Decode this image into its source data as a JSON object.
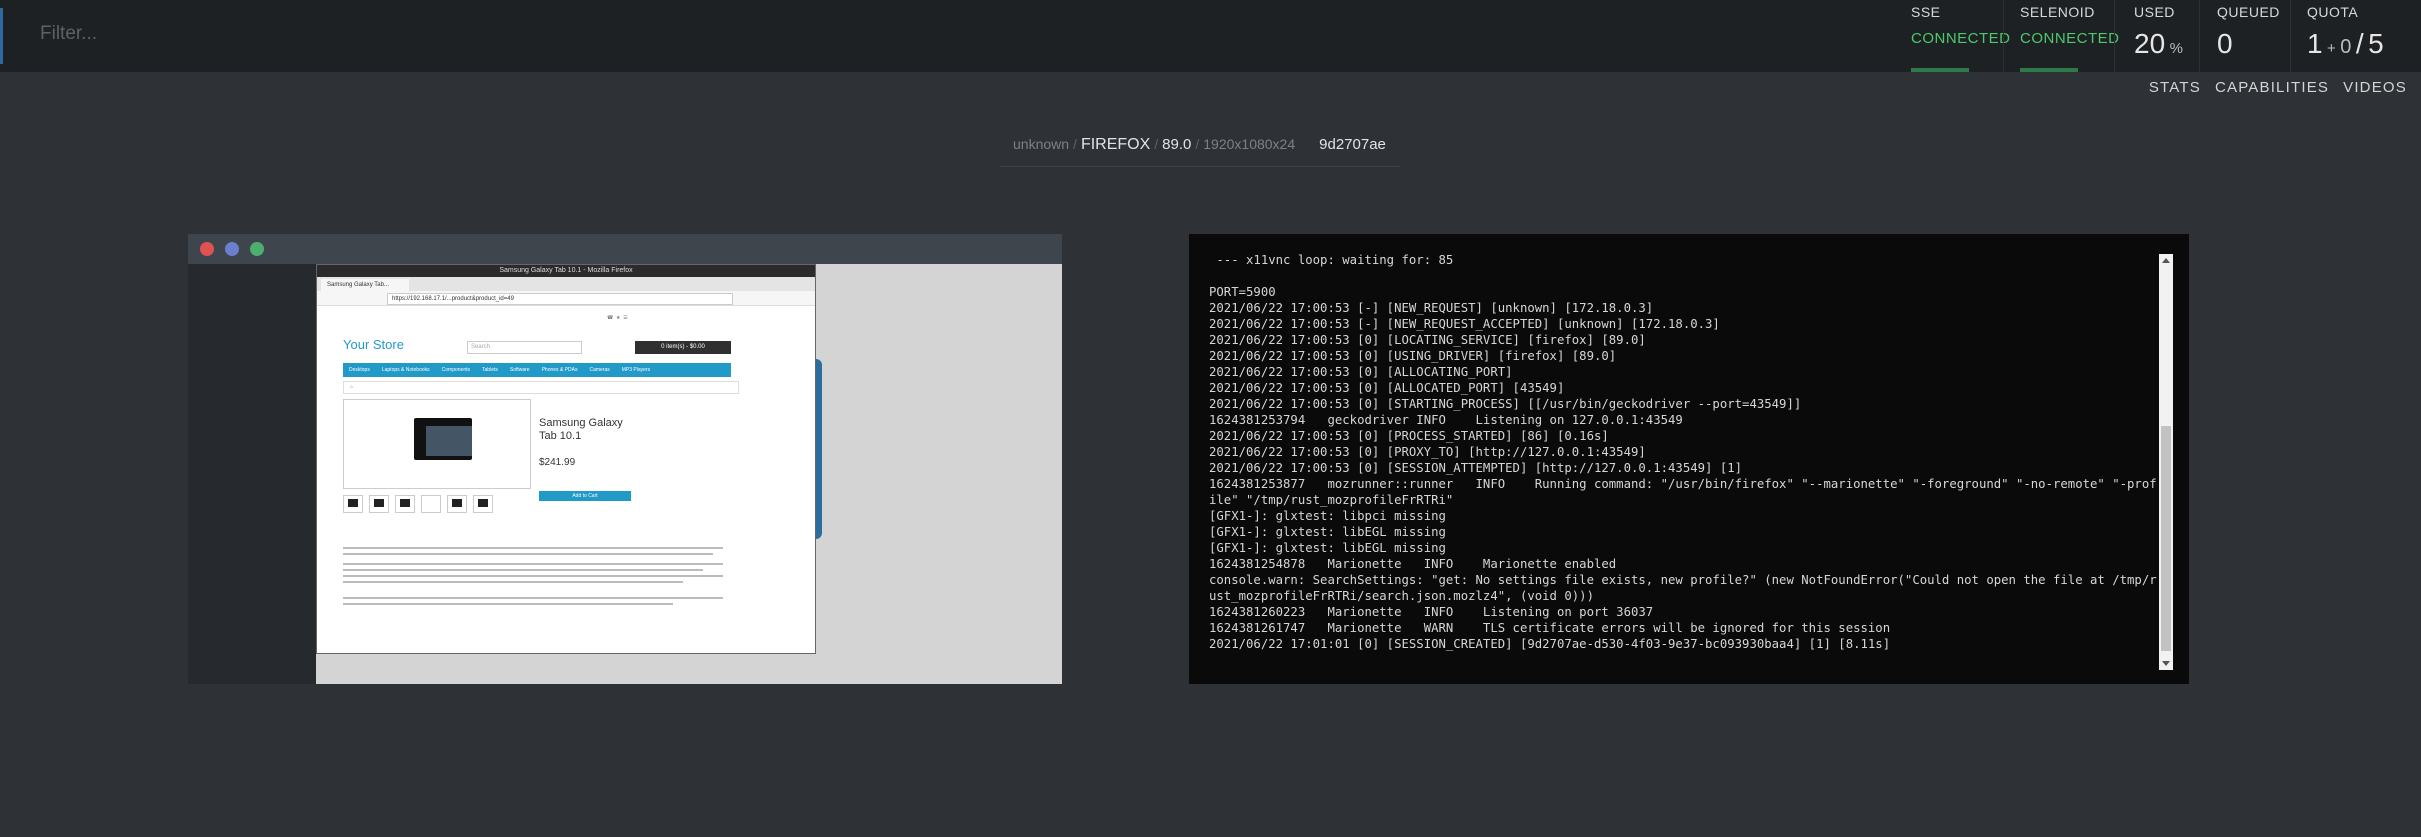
{
  "header": {
    "filter_placeholder": "Filter...",
    "sse": {
      "label": "SSE",
      "status": "CONNECTED"
    },
    "selenoid": {
      "label": "SELENOID",
      "status": "CONNECTED"
    },
    "used": {
      "label": "USED",
      "value": "20",
      "unit": "%"
    },
    "queued": {
      "label": "QUEUED",
      "value": "0"
    },
    "quota": {
      "label": "QUOTA",
      "used": "1",
      "plus": "+",
      "queued": "0",
      "slash": "/",
      "total": "5"
    },
    "accent_color": "#4cc96a"
  },
  "nav": [
    "STATS",
    "CAPABILITIES",
    "VIDEOS"
  ],
  "session": {
    "user": "unknown",
    "browser": "FIREFOX",
    "version": "89.0",
    "resolution": "1920x1080x24",
    "id": "9d2707ae"
  },
  "vnc": {
    "window_title": "Samsung Galaxy Tab 10.1 - Mozilla Firefox",
    "tab_title": "Samsung Galaxy Tab...",
    "url": "https://192.168.17.1/...product&product_id=49",
    "store_name": "Your Store",
    "search_placeholder": "Search",
    "cart_label": "0 item(s) - $0.00",
    "menu": [
      "Desktops",
      "Laptops & Notebooks",
      "Components",
      "Tablets",
      "Software",
      "Phones & PDAs",
      "Cameras",
      "MP3 Players"
    ],
    "product_title": "Samsung Galaxy Tab 10.1",
    "product_price": "$241.99",
    "add_to_cart": "Add to Cart"
  },
  "log": {
    "lines": [
      " --- x11vnc loop: waiting for: 85",
      "",
      "PORT=5900",
      "2021/06/22 17:00:53 [-] [NEW_REQUEST] [unknown] [172.18.0.3]",
      "2021/06/22 17:00:53 [-] [NEW_REQUEST_ACCEPTED] [unknown] [172.18.0.3]",
      "2021/06/22 17:00:53 [0] [LOCATING_SERVICE] [firefox] [89.0]",
      "2021/06/22 17:00:53 [0] [USING_DRIVER] [firefox] [89.0]",
      "2021/06/22 17:00:53 [0] [ALLOCATING_PORT]",
      "2021/06/22 17:00:53 [0] [ALLOCATED_PORT] [43549]",
      "2021/06/22 17:00:53 [0] [STARTING_PROCESS] [[/usr/bin/geckodriver --port=43549]]",
      "1624381253794   geckodriver INFO    Listening on 127.0.0.1:43549",
      "2021/06/22 17:00:53 [0] [PROCESS_STARTED] [86] [0.16s]",
      "2021/06/22 17:00:53 [0] [PROXY_TO] [http://127.0.0.1:43549]",
      "2021/06/22 17:00:53 [0] [SESSION_ATTEMPTED] [http://127.0.0.1:43549] [1]",
      "1624381253877   mozrunner::runner   INFO    Running command: \"/usr/bin/firefox\" \"--marionette\" \"-foreground\" \"-no-remote\" \"-profile\" \"/tmp/rust_mozprofileFrRTRi\"",
      "[GFX1-]: glxtest: libpci missing",
      "[GFX1-]: glxtest: libEGL missing",
      "[GFX1-]: glxtest: libEGL missing",
      "1624381254878   Marionette   INFO    Marionette enabled",
      "console.warn: SearchSettings: \"get: No settings file exists, new profile?\" (new NotFoundError(\"Could not open the file at /tmp/rust_mozprofileFrRTRi/search.json.mozlz4\", (void 0)))",
      "1624381260223   Marionette   INFO    Listening on port 36037",
      "1624381261747   Marionette   WARN    TLS certificate errors will be ignored for this session",
      "2021/06/22 17:01:01 [0] [SESSION_CREATED] [9d2707ae-d530-4f03-9e37-bc093930baa4] [1] [8.11s]"
    ]
  }
}
